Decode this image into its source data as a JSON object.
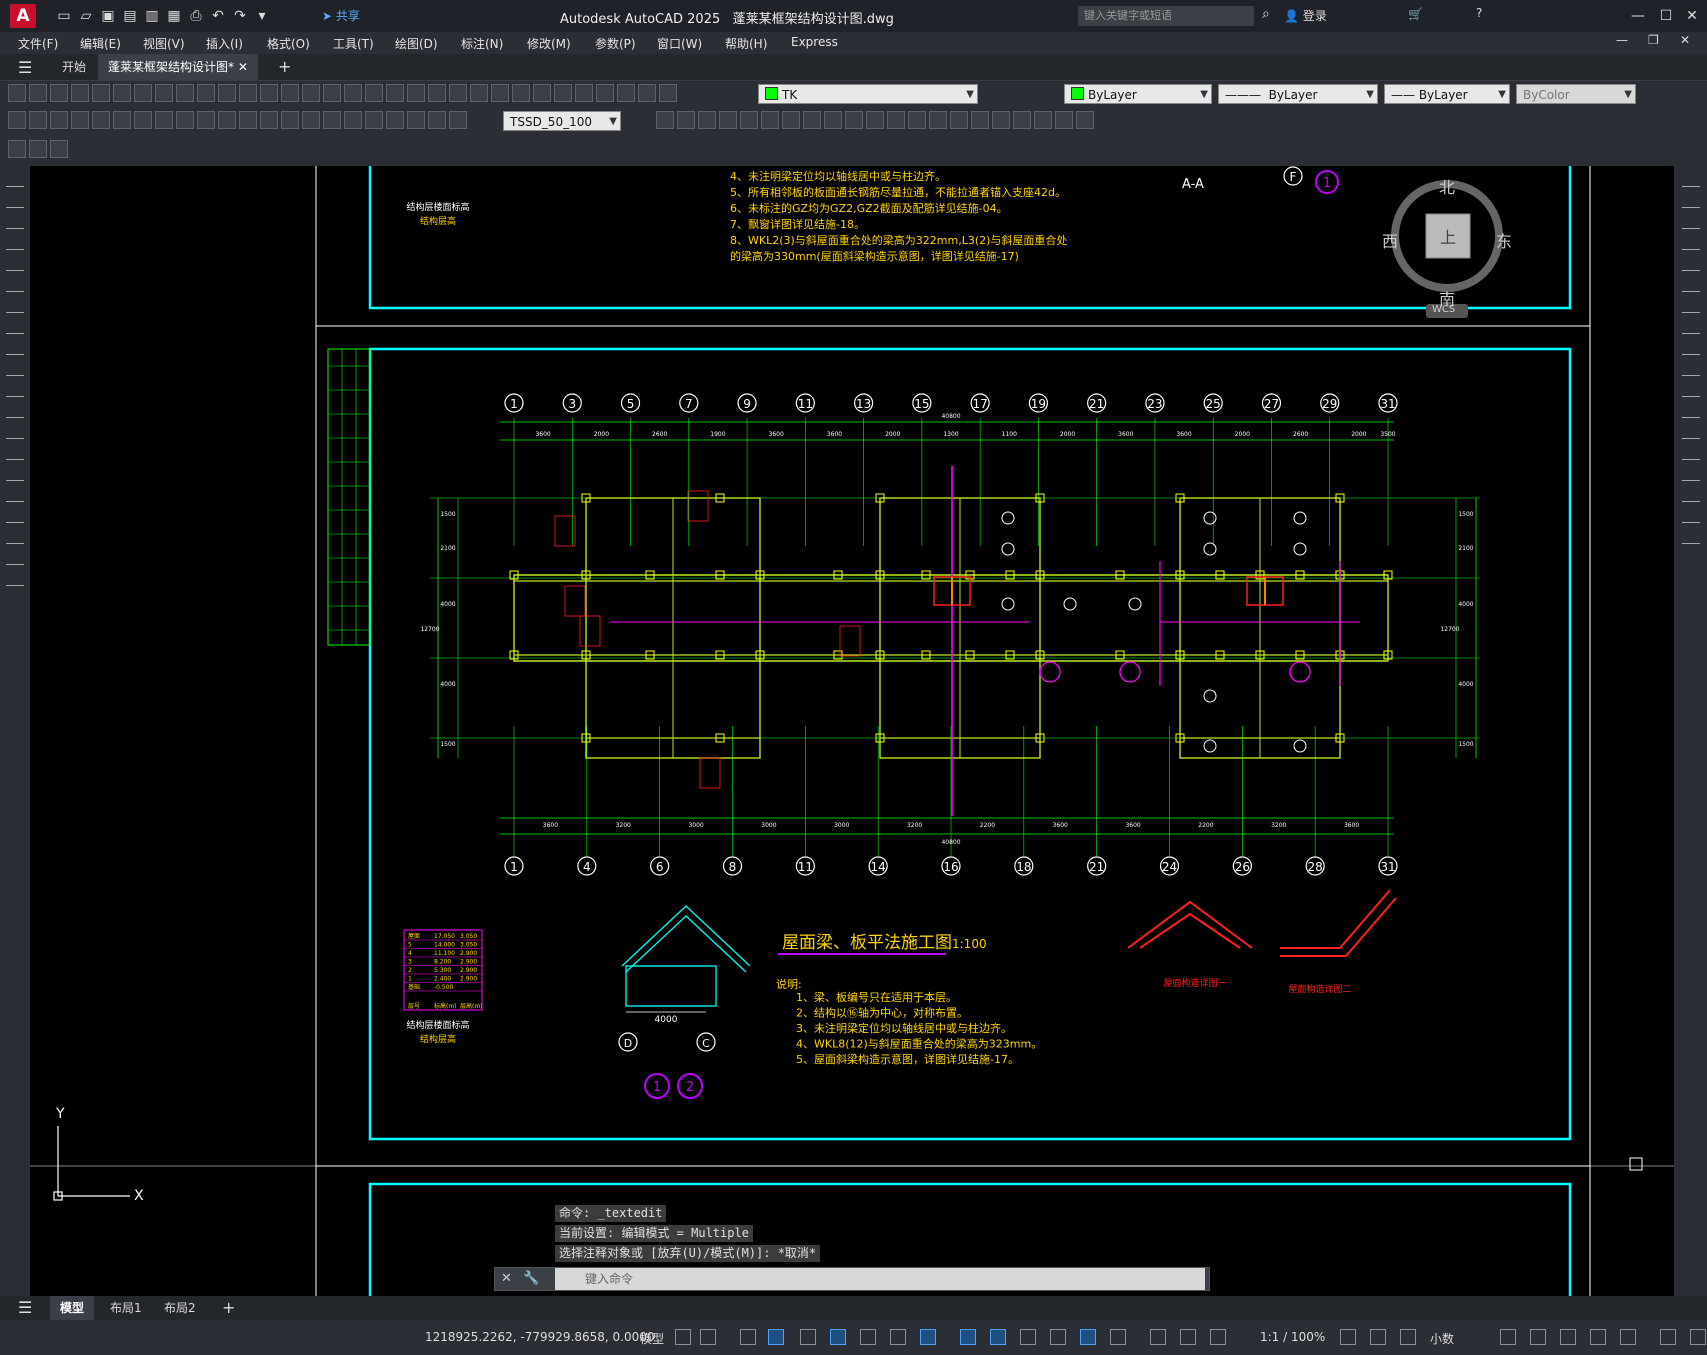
{
  "app": {
    "logo": "A",
    "title": "Autodesk AutoCAD 2025",
    "file": "蓬莱某框架结构设计图.dwg",
    "share": "共享",
    "search_placeholder": "键入关键字或短语",
    "login": "登录"
  },
  "menu": [
    "文件(F)",
    "编辑(E)",
    "视图(V)",
    "插入(I)",
    "格式(O)",
    "工具(T)",
    "绘图(D)",
    "标注(N)",
    "修改(M)",
    "参数(P)",
    "窗口(W)",
    "帮助(H)",
    "Express"
  ],
  "doc_tabs": [
    {
      "label": "开始"
    },
    {
      "label": "蓬莱某框架结构设计图*",
      "active": true
    }
  ],
  "toolbar": {
    "layer": "TK",
    "color": "ByLayer",
    "linetype": "ByLayer",
    "lineweight": "ByLayer",
    "plotstyle": "ByColor",
    "dimstyle": "TSSD_50_100"
  },
  "viewcube": {
    "north": "北",
    "south": "南",
    "east": "东",
    "west": "西",
    "top": "上",
    "wcs": "WCS"
  },
  "drawing": {
    "title": "屋面梁、板平法施工图",
    "scale": "1:100",
    "notes_title": "说明:",
    "notes": [
      "1、梁、板编号只在适用于本层。",
      "2、结构以⑯轴为中心，对称布置。",
      "3、未注明梁定位均以轴线居中或与柱边齐。",
      "4、WKL8(12)与斜屋面重合处的梁高为323mm。",
      "5、屋面斜梁构造示意图，详图详见结施-17。"
    ],
    "top_notes": [
      "4、未注明梁定位均以轴线居中或与柱边齐。",
      "5、所有相邻板的板面通长钢筋尽量拉通，不能拉通者锚入支座42d。",
      "6、未标注的GZ均为GZ2,GZ2截面及配筋详见结施-04。",
      "7、飘窗详图详见结施-18。",
      "8、WKL2(3)与斜屋面重合处的梁高为322mm,L3(2)与斜屋面重合处",
      "的梁高为330mm(屋面斜梁构造示意图，详图详见结施-17)"
    ],
    "top_axes": [
      "1",
      "3",
      "5",
      "7",
      "9",
      "11",
      "13",
      "15",
      "17",
      "19",
      "21",
      "23",
      "25",
      "27",
      "29",
      "31"
    ],
    "bottom_axes": [
      "1",
      "4",
      "6",
      "8",
      "11",
      "14",
      "16",
      "18",
      "21",
      "24",
      "26",
      "28",
      "31"
    ],
    "top_dims": [
      "3600",
      "2000",
      "2600",
      "1900",
      "3600",
      "3600",
      "2000",
      "1300",
      "1100",
      "2000",
      "3600",
      "3600",
      "2000",
      "2600",
      "2000",
      "3500"
    ],
    "bottom_dims": [
      "3600",
      "3200",
      "3000",
      "3000",
      "3000",
      "3200",
      "2200",
      "3600",
      "3600",
      "2200",
      "3200",
      "3600"
    ],
    "total_dim": "40800",
    "left_dims": [
      "1500",
      "2100",
      "4000",
      "4000",
      "1500"
    ],
    "left_total": "12700",
    "section_label": "A-A",
    "section_width": "4000",
    "section_axes": [
      "D",
      "C"
    ],
    "detail1": "屋面构造详图一",
    "detail2": "屋面构造详图二",
    "floor_table_title": "结构层楼面标高",
    "floor_table_sub": "结构层高",
    "floor_rows": [
      [
        "屋面",
        "17.050",
        "3.050"
      ],
      [
        "5",
        "14.000",
        "3.050"
      ],
      [
        "4",
        "11.100",
        "2.900"
      ],
      [
        "3",
        "8.200",
        "2.900"
      ],
      [
        "2",
        "5.300",
        "2.900"
      ],
      [
        "1",
        "2.400",
        "2.900"
      ],
      [
        "基础",
        "-0.500",
        ""
      ]
    ],
    "floor_header": [
      "层号",
      "标高(m)",
      "层高(m)"
    ],
    "sheet_marks": [
      "1",
      "2"
    ],
    "axis_f": "F"
  },
  "command": {
    "history": [
      "命令: _textedit",
      "当前设置: 编辑模式 = Multiple",
      "选择注释对象或 [放弃(U)/模式(M)]: *取消*"
    ],
    "placeholder": "键入命令"
  },
  "layout_tabs": [
    {
      "label": "模型",
      "active": true
    },
    {
      "label": "布局1"
    },
    {
      "label": "布局2"
    }
  ],
  "status": {
    "coords": "1218925.2262, -779929.8658, 0.0000",
    "space": "模型",
    "scale": "1:1 / 100%",
    "units": "小数"
  }
}
